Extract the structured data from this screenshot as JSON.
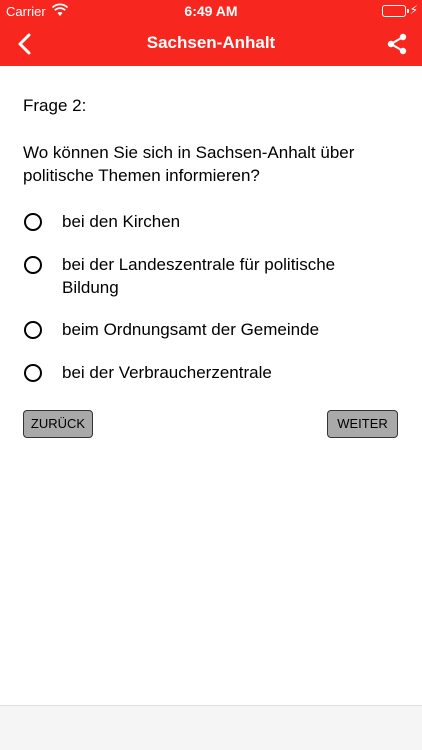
{
  "status_bar": {
    "carrier": "Carrier",
    "time": "6:49 AM",
    "battery_color": "#4cd964"
  },
  "nav_bar": {
    "title": "Sachsen-Anhalt",
    "back_icon": "chevron-left-icon",
    "share_icon": "share-icon",
    "color": "#f7271f"
  },
  "quiz": {
    "question_label": "Frage 2:",
    "question_text": "Wo können Sie sich in Sachsen-Anhalt über politische Themen informieren?",
    "answers": [
      {
        "text": "bei den Kirchen"
      },
      {
        "text": "bei der Landeszentrale für politische Bildung"
      },
      {
        "text": "beim Ordnungsamt der Gemeinde"
      },
      {
        "text": "bei der Verbraucherzentrale"
      }
    ],
    "back_label": "ZURÜCK",
    "next_label": "WEITER"
  }
}
